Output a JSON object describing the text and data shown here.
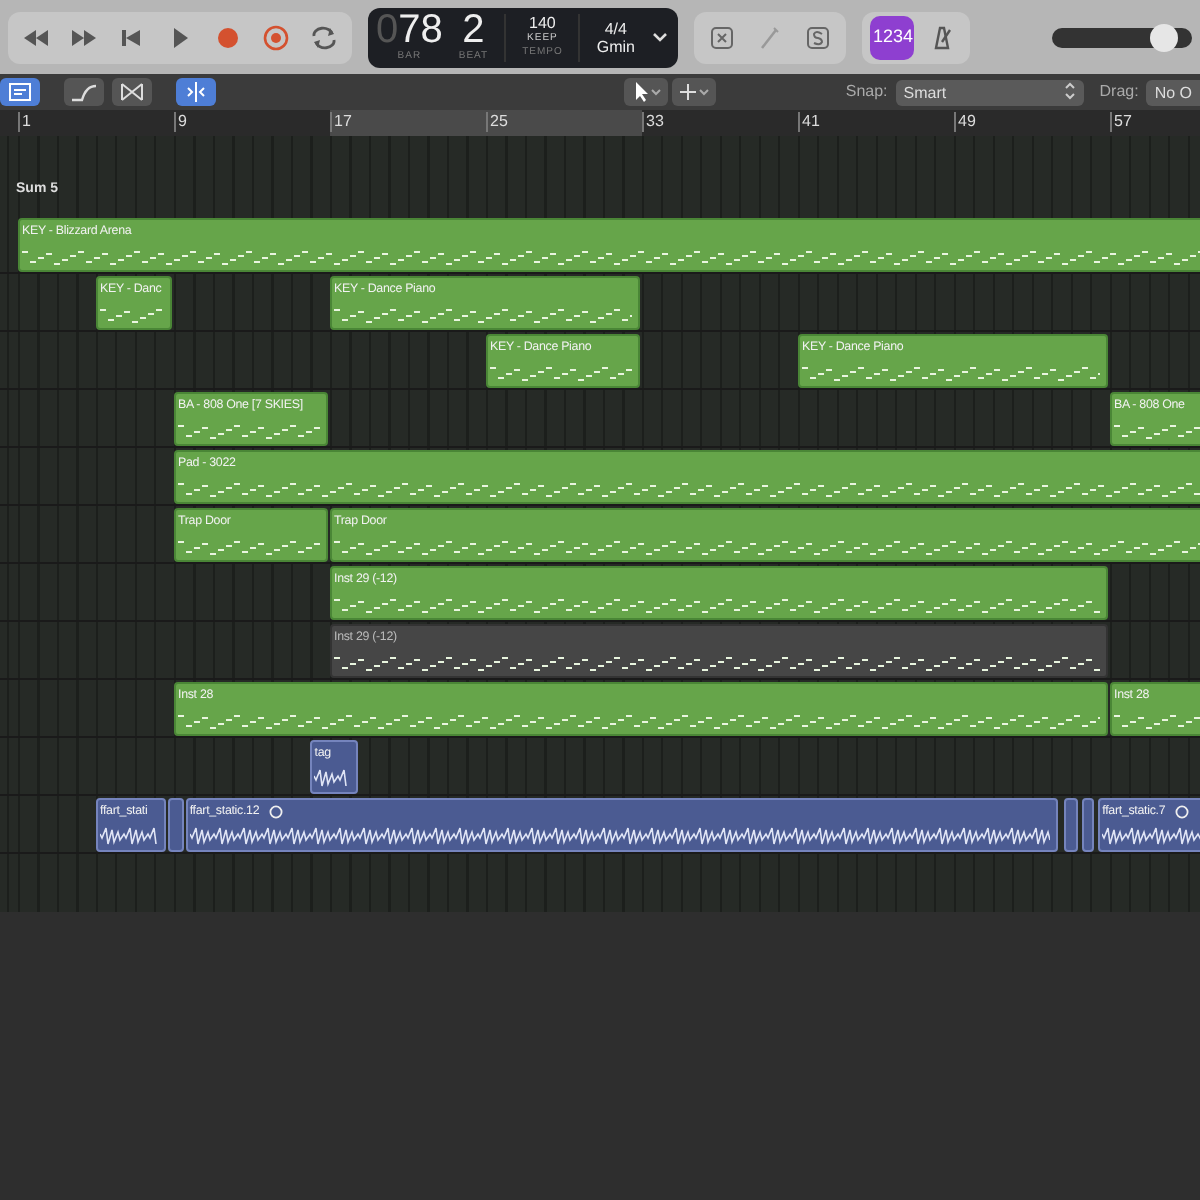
{
  "lcd": {
    "bar_lead": "0",
    "bar": "78",
    "beat": "2",
    "bar_label": "BAR",
    "beat_label": "BEAT",
    "tempo": "140",
    "tempo_mode": "KEEP",
    "tempo_label": "TEMPO",
    "signature": "4/4",
    "key": "Gmin"
  },
  "count_in": {
    "label": "1234",
    "on": true
  },
  "master_volume": {
    "level": 0.88
  },
  "edit_tools": [
    {
      "kind": "view",
      "selected": true
    },
    {
      "kind": "automation",
      "selected": false
    },
    {
      "kind": "crossfade",
      "selected": false
    },
    {
      "kind": "flex",
      "selected": true
    }
  ],
  "snap": {
    "label": "Snap:",
    "value": "Smart"
  },
  "drag": {
    "label": "Drag:",
    "value": "No O"
  },
  "ruler": [
    "1",
    "9",
    "17",
    "25",
    "33",
    "41",
    "49",
    "57"
  ],
  "folder": {
    "label": "Sum 5"
  },
  "tracks": [
    {
      "regions": [
        {
          "kind": "midi",
          "name": "KEY - Blizzard Arena",
          "muted": false
        }
      ]
    },
    {
      "regions": [
        {
          "kind": "midi",
          "name": "KEY - Danc",
          "muted": false
        },
        {
          "kind": "midi",
          "name": "KEY - Dance Piano",
          "muted": false
        }
      ]
    },
    {
      "regions": [
        {
          "kind": "midi",
          "name": "KEY - Dance Piano",
          "muted": false
        },
        {
          "kind": "midi",
          "name": "KEY - Dance Piano",
          "muted": false
        }
      ]
    },
    {
      "regions": [
        {
          "kind": "midi",
          "name": "BA - 808 One [7 SKIES]",
          "muted": false
        },
        {
          "kind": "midi",
          "name": "BA - 808 One",
          "muted": false
        }
      ]
    },
    {
      "regions": [
        {
          "kind": "midi",
          "name": "Pad - 3022",
          "muted": false
        }
      ]
    },
    {
      "regions": [
        {
          "kind": "midi",
          "name": "Trap Door",
          "muted": false
        },
        {
          "kind": "midi",
          "name": "Trap Door",
          "muted": false
        }
      ]
    },
    {
      "regions": [
        {
          "kind": "midi",
          "name": "Inst 29 (-12)",
          "muted": false
        }
      ]
    },
    {
      "regions": [
        {
          "kind": "midi",
          "name": "Inst 29 (-12)",
          "muted": true
        }
      ]
    },
    {
      "regions": [
        {
          "kind": "midi",
          "name": "Inst 28",
          "muted": false
        },
        {
          "kind": "midi",
          "name": "Inst 28",
          "muted": false
        }
      ]
    },
    {
      "regions": [
        {
          "kind": "audio",
          "name": "tag",
          "looped": false
        }
      ]
    },
    {
      "regions": [
        {
          "kind": "audio",
          "name": "ffart_stati",
          "looped": false
        },
        {
          "kind": "audio",
          "looped": false
        },
        {
          "kind": "audio",
          "name": "ffart_static.12",
          "looped": true
        },
        {
          "kind": "audio",
          "looped": false
        },
        {
          "kind": "audio",
          "looped": false
        },
        {
          "kind": "audio",
          "name": "ffart_static.7",
          "looped": true
        }
      ]
    }
  ]
}
